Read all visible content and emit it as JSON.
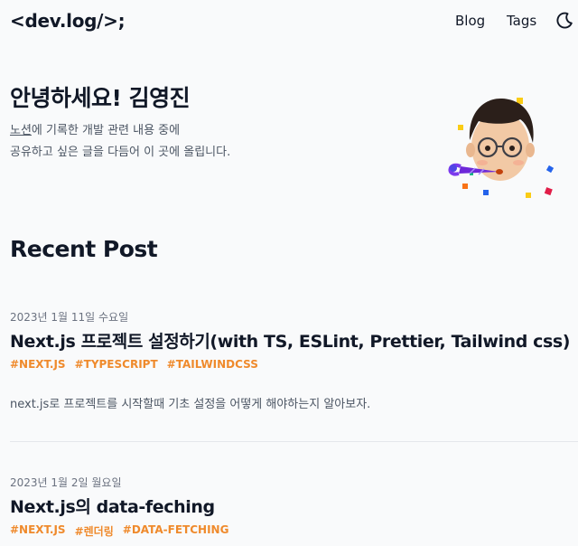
{
  "header": {
    "logo": "<dev.log/>;",
    "nav": [
      "Blog",
      "Tags"
    ],
    "theme_icon": "moon-icon"
  },
  "intro": {
    "greeting": "안녕하세요! 김영진",
    "line1_link": "노션",
    "line1_rest": "에 기록한 개발 관련 내용 중에",
    "line2": "공유하고 싶은 글을 다듬어 이 곳에 올립니다."
  },
  "recent": {
    "heading": "Recent Post",
    "posts": [
      {
        "date": "2023년 1월 11일 수요일",
        "title": "Next.js 프로젝트 설정하기(with TS, ESLint, Prettier, Tailwind css)",
        "tags": [
          "#NEXT.JS",
          "#TYPESCRIPT",
          "#TAILWINDCSS"
        ],
        "description": "next.js로 프로젝트를 시작할때 기초 설정을 어떻게 해야하는지 알아보자."
      },
      {
        "date": "2023년 1월 2일 월요일",
        "title": "Next.js의 data-feching",
        "tags": [
          "#NEXT.JS",
          "#렌더링",
          "#DATA-FETCHING"
        ]
      }
    ]
  },
  "colors": {
    "tag": "#ef8a2c",
    "text": "#111827",
    "muted": "#4b5563",
    "background": "#f9fafb"
  }
}
